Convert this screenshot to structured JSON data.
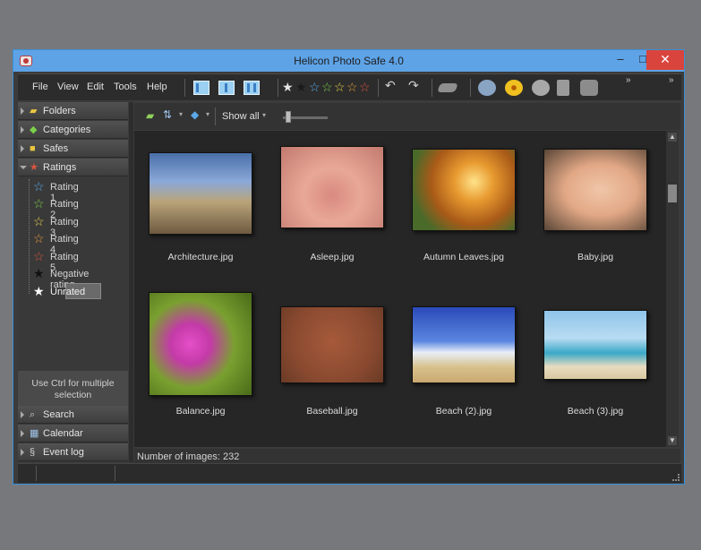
{
  "window": {
    "title": "Helicon Photo Safe 4.0"
  },
  "menu": [
    {
      "label": "File"
    },
    {
      "label": "View"
    },
    {
      "label": "Edit"
    },
    {
      "label": "Tools"
    },
    {
      "label": "Help"
    }
  ],
  "toolbar": {
    "rating_stars": [
      "#e6e6e6",
      "#1a1a1a",
      "#5aa8e8",
      "#7ccf4a",
      "#e8d34a",
      "#e89b3c",
      "#d9553f"
    ]
  },
  "sidebar": {
    "sections": [
      {
        "label": "Folders",
        "icon": "folder-icon"
      },
      {
        "label": "Categories",
        "icon": "tag-icon"
      },
      {
        "label": "Safes",
        "icon": "lock-icon"
      },
      {
        "label": "Ratings",
        "icon": "star-icon"
      }
    ],
    "ratings": [
      {
        "label": "Rating 1",
        "color": "#5aa8e8"
      },
      {
        "label": "Rating 2",
        "color": "#7ccf4a"
      },
      {
        "label": "Rating 3",
        "color": "#e8d34a"
      },
      {
        "label": "Rating 4",
        "color": "#e89b3c"
      },
      {
        "label": "Rating 5",
        "color": "#d9553f"
      },
      {
        "label": "Negative rating",
        "color": "#111111"
      },
      {
        "label": "Unrated",
        "color": "#ffffff"
      }
    ],
    "hint": "Use Ctrl for multiple selection",
    "bottom_sections": [
      {
        "label": "Search",
        "icon": "search-icon"
      },
      {
        "label": "Calendar",
        "icon": "calendar-icon"
      },
      {
        "label": "Event log",
        "icon": "log-icon"
      }
    ]
  },
  "content_toolbar": {
    "filter_label": "Show all"
  },
  "images": [
    {
      "name": "Architecture.jpg"
    },
    {
      "name": "Asleep.jpg"
    },
    {
      "name": "Autumn Leaves.jpg"
    },
    {
      "name": "Baby.jpg"
    },
    {
      "name": "Balance.jpg"
    },
    {
      "name": "Baseball.jpg"
    },
    {
      "name": "Beach (2).jpg"
    },
    {
      "name": "Beach (3).jpg"
    }
  ],
  "status": {
    "count_text": "Number of images: 232"
  }
}
